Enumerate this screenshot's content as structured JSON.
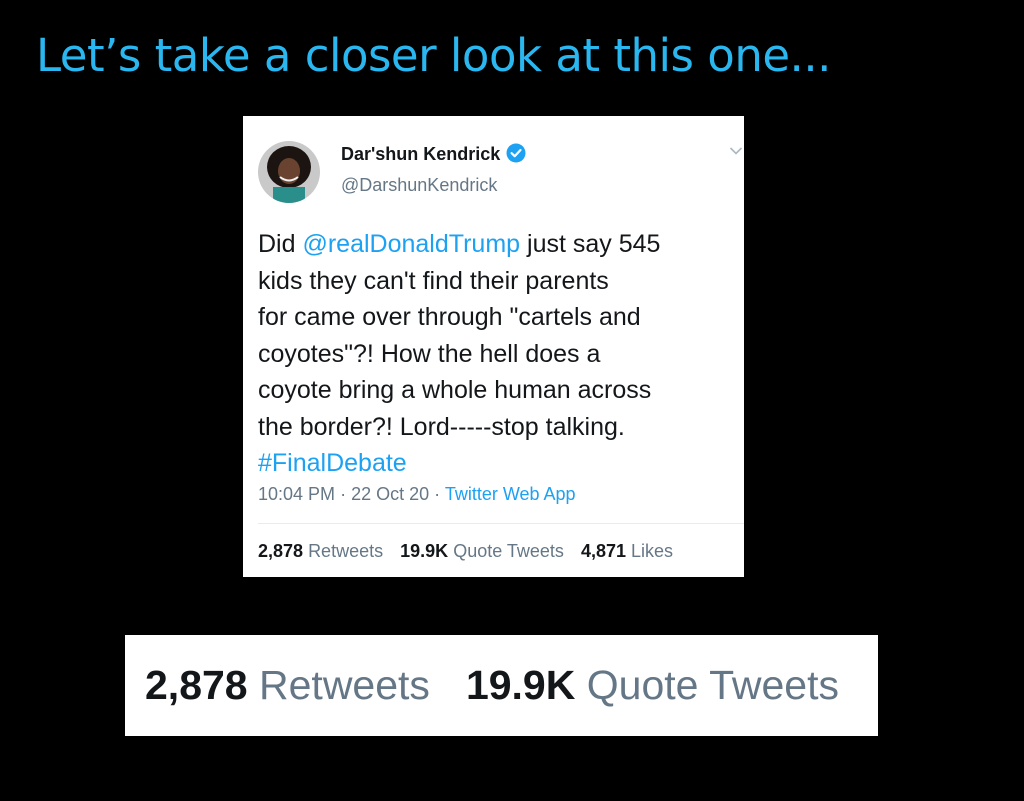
{
  "headline": "Let’s take a closer look at this one...",
  "tweet": {
    "author": {
      "name": "Dar'shun Kendrick",
      "handle": "@DarshunKendrick"
    },
    "text_lines": [
      {
        "pre": "Did ",
        "mention": "@realDonaldTrump",
        "post": " just say 545"
      },
      {
        "text": "kids they can't find their parents"
      },
      {
        "text": "for came over through \"cartels and"
      },
      {
        "text": "coyotes\"?! How the hell does a"
      },
      {
        "text": "coyote bring a whole human across"
      },
      {
        "text": "the border?!  Lord-----stop talking."
      },
      {
        "hashtag": "#FinalDebate"
      }
    ],
    "time": "10:04 PM",
    "date": "22 Oct 20",
    "separator": "·",
    "source": "Twitter Web App",
    "stats": {
      "retweets": {
        "value": "2,878",
        "label": "Retweets"
      },
      "quote_tweets": {
        "value": "19.9K",
        "label": "Quote Tweets"
      },
      "likes": {
        "value": "4,871",
        "label": "Likes"
      }
    }
  },
  "zoom": {
    "retweets": {
      "value": "2,878",
      "label": "Retweets"
    },
    "quote_tweets": {
      "value": "19.9K",
      "label": "Quote Tweets"
    }
  },
  "icons": {
    "verified": "verified-badge-icon",
    "caret": "chevron-down-icon",
    "avatar": "profile-photo"
  },
  "colors": {
    "background": "#000000",
    "headline": "#2ab7f0",
    "link": "#1da1f2",
    "text": "#14171a",
    "muted": "#657786",
    "divider": "#e6ecf0",
    "card": "#ffffff"
  }
}
